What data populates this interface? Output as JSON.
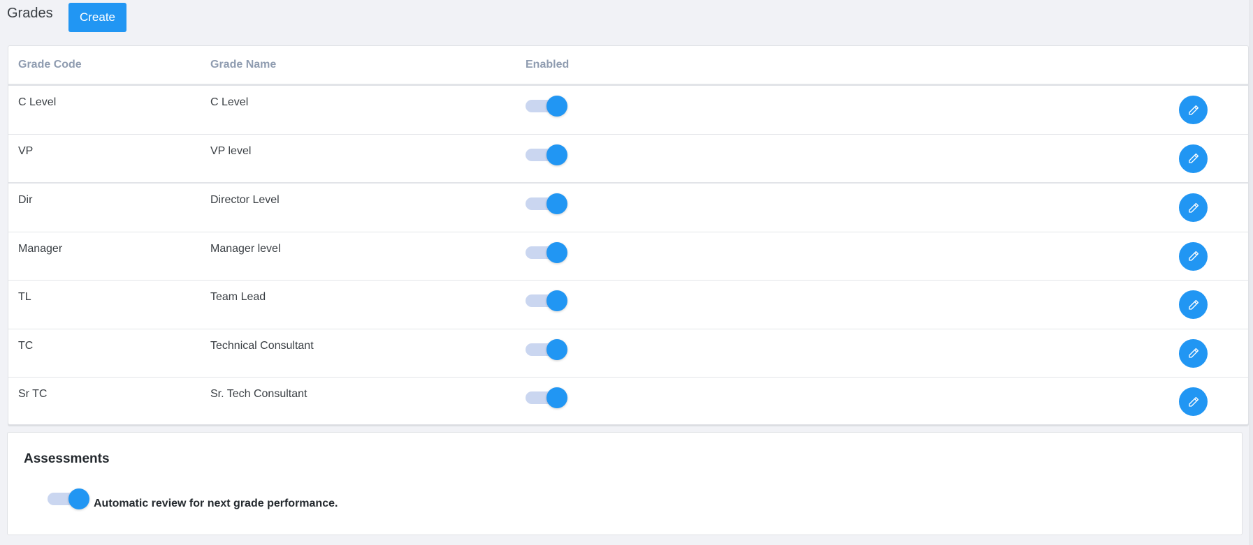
{
  "header": {
    "title": "Grades",
    "create_label": "Create"
  },
  "table": {
    "columns": [
      "Grade Code",
      "Grade Name",
      "Enabled"
    ],
    "rows": [
      {
        "code": "C Level",
        "name": "C Level",
        "enabled": true
      },
      {
        "code": "VP",
        "name": "VP level",
        "enabled": true
      },
      {
        "code": "Dir",
        "name": "Director Level",
        "enabled": true
      },
      {
        "code": "Manager",
        "name": "Manager level",
        "enabled": true
      },
      {
        "code": "TL",
        "name": "Team Lead",
        "enabled": true
      },
      {
        "code": "TC",
        "name": "Technical Consultant",
        "enabled": true
      },
      {
        "code": "Sr TC",
        "name": "Sr. Tech Consultant",
        "enabled": true
      }
    ]
  },
  "assessments": {
    "title": "Assessments",
    "toggle_label": "Automatic review for next grade performance.",
    "enabled": true
  },
  "colors": {
    "accent": "#2196f3",
    "track": "#cad6f0",
    "header_text": "#8f9cb0"
  }
}
